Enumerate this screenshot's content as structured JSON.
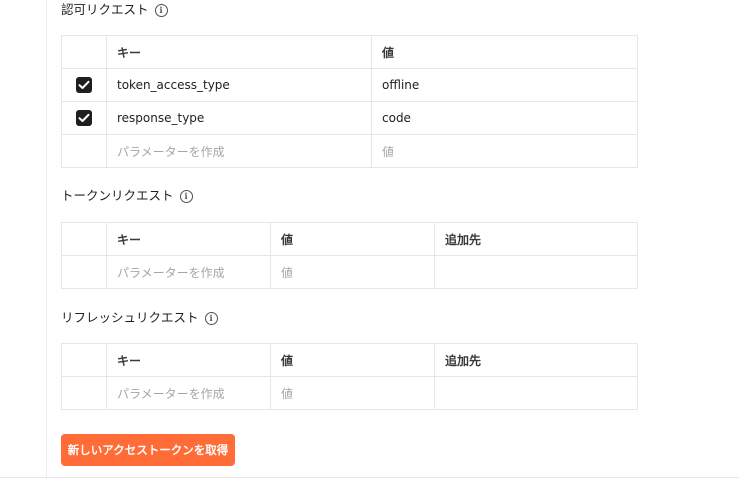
{
  "auth_request": {
    "title": "認可リクエスト",
    "headers": {
      "key": "キー",
      "value": "値"
    },
    "rows": [
      {
        "key": "token_access_type",
        "value": "offline",
        "checked": true
      },
      {
        "key": "response_type",
        "value": "code",
        "checked": true
      }
    ],
    "new_row": {
      "key_placeholder": "パラメーターを作成",
      "value_placeholder": "値"
    }
  },
  "token_request": {
    "title": "トークンリクエスト",
    "headers": {
      "key": "キー",
      "value": "値",
      "add_to": "追加先"
    },
    "new_row": {
      "key_placeholder": "パラメーターを作成",
      "value_placeholder": "値"
    }
  },
  "refresh_request": {
    "title": "リフレッシュリクエスト",
    "headers": {
      "key": "キー",
      "value": "値",
      "add_to": "追加先"
    },
    "new_row": {
      "key_placeholder": "パラメーターを作成",
      "value_placeholder": "値"
    }
  },
  "actions": {
    "get_token_label": "新しいアクセストークンを取得"
  },
  "colors": {
    "accent": "#ff6c37",
    "checkbox": "#1f1f1f",
    "border": "#e6e6e6",
    "placeholder": "#a6a6a6"
  },
  "icons": {
    "info": "info-icon",
    "check": "checkmark-icon"
  }
}
